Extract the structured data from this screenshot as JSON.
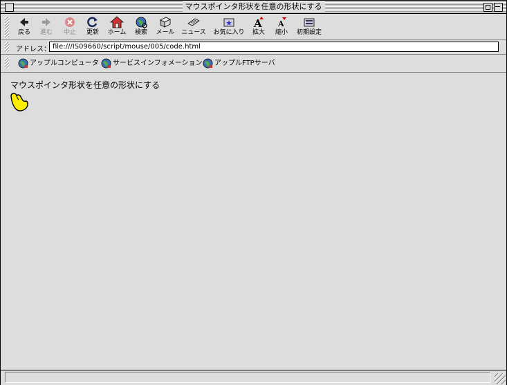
{
  "window": {
    "title": "マウスポインタ形状を任意の形状にする"
  },
  "toolbar": {
    "back": "戻る",
    "forward": "進む",
    "stop": "中止",
    "refresh": "更新",
    "home": "ホーム",
    "search": "検索",
    "mail": "メール",
    "news": "ニュース",
    "favorites": "お気に入り",
    "larger": "拡大",
    "smaller": "縮小",
    "preferences": "初期設定"
  },
  "address": {
    "label": "アドレス：",
    "url": "file:///IS09660/script/mouse/005/code.html"
  },
  "favorites_bar": {
    "items": [
      "アップルコンピュータ",
      "サービスインフォメーション",
      "アップルFTPサーバ"
    ]
  },
  "content": {
    "text": "マウスポインタ形状を任意の形状にする"
  },
  "colors": {
    "cursor_fill": "#ffee00",
    "accent": "#cc0000"
  }
}
